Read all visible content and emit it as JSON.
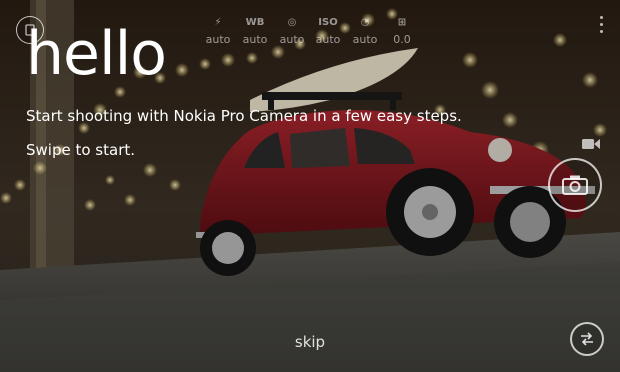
{
  "app": {
    "title": "hello",
    "intro_text": "Start shooting with Nokia Pro Camera in a few easy steps.",
    "swipe_text": "Swipe to start.",
    "skip_label": "skip"
  },
  "settings_bar": [
    {
      "name": "flash",
      "icon": "flash-icon",
      "label": "",
      "value": "auto"
    },
    {
      "name": "white-balance",
      "icon": "wb-icon",
      "label": "WB",
      "value": "auto"
    },
    {
      "name": "focus",
      "icon": "focus-icon",
      "label": "",
      "value": "auto"
    },
    {
      "name": "iso",
      "icon": "iso-icon",
      "label": "ISO",
      "value": "auto"
    },
    {
      "name": "shutter",
      "icon": "shutter-icon",
      "label": "",
      "value": "auto"
    },
    {
      "name": "exposure",
      "icon": "exposure-icon",
      "label": "",
      "value": "0.0"
    }
  ],
  "colors": {
    "text": "#ffffff",
    "car": "#8f1a22",
    "surfboard": "#e8e0c8"
  }
}
